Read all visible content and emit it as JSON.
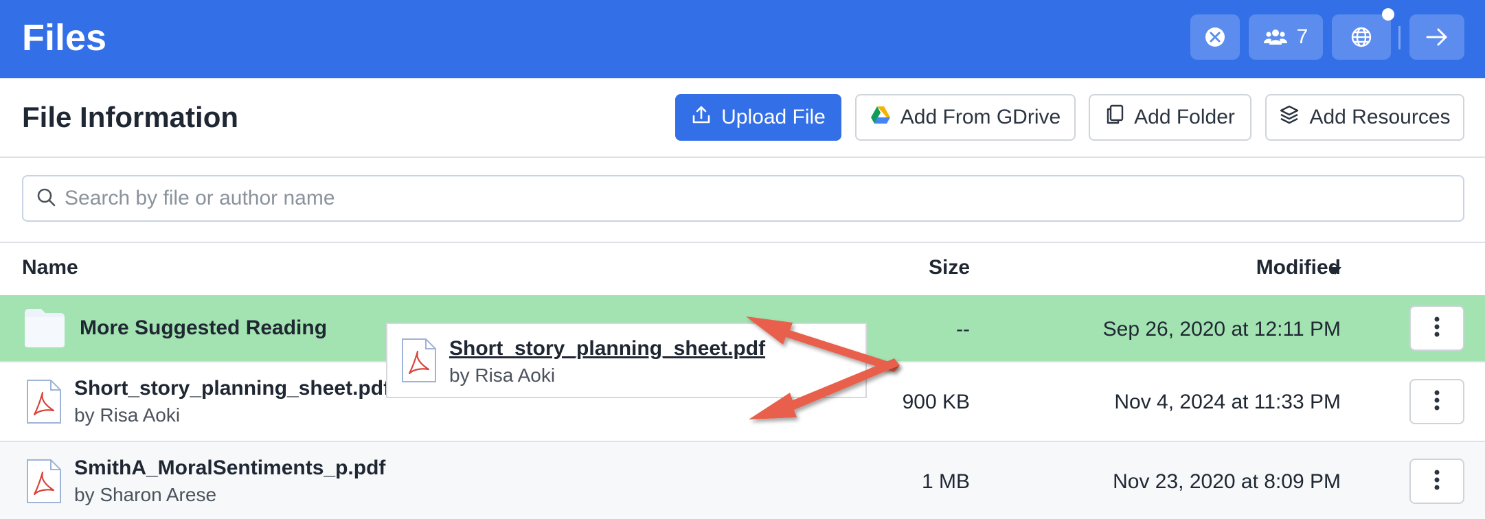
{
  "app": {
    "title": "Files"
  },
  "topbar": {
    "participants_count": "7",
    "icons": [
      "chat-icon",
      "users-icon",
      "globe-icon",
      "arrow-right-icon"
    ]
  },
  "header": {
    "title": "File Information",
    "buttons": {
      "upload": "Upload File",
      "gdrive": "Add From GDrive",
      "folder": "Add Folder",
      "resources": "Add Resources"
    }
  },
  "search": {
    "placeholder": "Search by file or author name",
    "value": ""
  },
  "table": {
    "columns": {
      "name": "Name",
      "size": "Size",
      "modified": "Modified"
    },
    "sort": {
      "column": "Modified",
      "direction": "descending"
    },
    "rows": [
      {
        "type": "folder",
        "name": "More Suggested Reading",
        "author": "",
        "size": "--",
        "modified": "Sep 26, 2020 at 12:11 PM",
        "highlighted": true
      },
      {
        "type": "pdf",
        "name": "Short_story_planning_sheet.pdf",
        "author": "by Risa Aoki",
        "size": "900 KB",
        "modified": "Nov 4, 2024 at 11:33 PM"
      },
      {
        "type": "pdf",
        "name": "SmithA_MoralSentiments_p.pdf",
        "author": "by Sharon Arese",
        "size": "1 MB",
        "modified": "Nov 23, 2020 at 8:09 PM"
      }
    ]
  },
  "drag": {
    "name": "Short_story_planning_sheet.pdf",
    "author": "by Risa Aoki"
  },
  "colors": {
    "brand": "#336fe6",
    "highlight_row": "#a3e2b1",
    "annotation_arrow": "#e8604c",
    "pdf_red": "#d9443a"
  }
}
